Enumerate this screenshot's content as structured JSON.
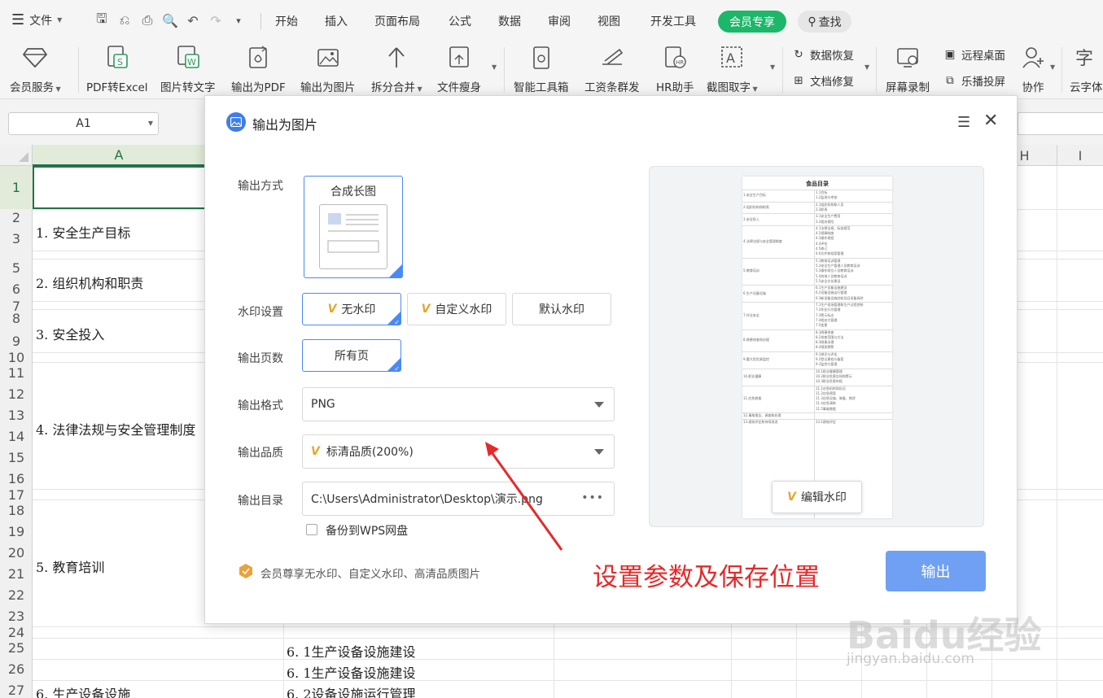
{
  "menubar": {
    "file": "文件",
    "items": [
      "开始",
      "插入",
      "页面布局",
      "公式",
      "数据",
      "审阅",
      "视图",
      "开发工具"
    ],
    "member": "会员专享",
    "search": "查找"
  },
  "ribbon": {
    "member_service": "会员服务",
    "pdf_to_excel": "PDF转Excel",
    "img_to_text": "图片转文字",
    "export_pdf": "输出为PDF",
    "export_img": "输出为图片",
    "split_merge": "拆分合并",
    "slim": "文件瘦身",
    "toolbox": "智能工具箱",
    "payslip": "工资条群发",
    "hr": "HR助手",
    "screenshot_text": "截图取字",
    "data_recovery": "数据恢复",
    "doc_repair": "文档修复",
    "screen_record": "屏幕录制",
    "remote_desktop": "远程桌面",
    "cast": "乐播投屏",
    "collab": "协作",
    "cloud_font": "云字体"
  },
  "namebox": {
    "value": "A1"
  },
  "sheet": {
    "col_a": "A",
    "col_h": "H",
    "col_i": "I",
    "rows": [
      "1",
      "2",
      "3",
      "5",
      "6",
      "7",
      "8",
      "9",
      "10",
      "11",
      "12",
      "13",
      "14",
      "15",
      "16",
      "17",
      "18",
      "19",
      "20",
      "21",
      "22",
      "23",
      "24",
      "25",
      "26",
      "27"
    ],
    "cells_a": [
      "1. 安全生产目标",
      "2. 组织机构和职责",
      "3. 安全投入",
      "4. 法律法规与安全管理制度",
      "5. 教育培训",
      "6. 生产设备设施"
    ],
    "cells_b": [
      "6. 1生产设备设施建设",
      "6. 1生产设备设施建设",
      "6. 2设备设施运行管理"
    ]
  },
  "dialog": {
    "title": "输出为图片",
    "label_mode": "输出方式",
    "mode_long": "合成长图",
    "label_watermark": "水印设置",
    "wm_none": "无水印",
    "wm_custom": "自定义水印",
    "wm_default": "默认水印",
    "label_pages": "输出页数",
    "pages_all": "所有页",
    "label_format": "输出格式",
    "format_value": "PNG",
    "label_quality": "输出品质",
    "quality_value": "标清品质(200%)",
    "label_dir": "输出目录",
    "dir_value": "C:\\Users\\Administrator\\Desktop\\演示.png",
    "backup": "备份到WPS网盘",
    "promo": "会员尊享无水印、自定义水印、高清品质图片",
    "output_btn": "输出",
    "edit_watermark": "编辑水印"
  },
  "preview": {
    "title": "食品目录",
    "sections": [
      "1.安全生产目标",
      "2.组织机构和职责",
      "3.安全投入",
      "4.法律法规与安全管理制度",
      "5.教育培训",
      "6.生产设备设施",
      "7.作业安全",
      "8.隐患排查和治理",
      "9.重大危险源监控",
      "10.职业健康",
      "11.应急救援",
      "12.事故报告、调查和处理",
      "13.绩效评定和持续改进"
    ],
    "subs": [
      "1.1目标",
      "1.2监测与考核",
      "2.1组织机构和人员",
      "2.2职责",
      "3.1安全生产费用",
      "3.2相关保险",
      "4.1法律法规、标准规范",
      "4.2规章制度",
      "4.3操作规程",
      "4.4评估",
      "4.5修订",
      "4.6文件和档案管理",
      "5.1教育培训管理",
      "5.2安全生产管理人员教育培训",
      "5.3操作岗位人员教育培训",
      "5.4其他人员教育培训",
      "5.5安全文化建设",
      "6.1生产设备设施建设",
      "6.2设备设施运行管理",
      "6.3新设备设施验收及旧设备拆除",
      "7.1生产现场管理和生产过程控制",
      "7.2作业行为管理",
      "7.3警示标志",
      "7.4相关方管理",
      "7.5变更",
      "8.1隐患排查",
      "8.2排查范围与方法",
      "8.3隐患治理",
      "8.4预测预警",
      "9.1辨识与评估",
      "9.2登记建档与备案",
      "9.3监控与管理",
      "10.1职业健康管理",
      "10.2职业危害告知和警示",
      "10.3职业危害申报",
      "11.1应急机构和队伍",
      "11.2应急预案",
      "11.3应急设施、装备、物资",
      "11.4应急演练",
      "11.5事故救援",
      "13.1绩效评定"
    ]
  },
  "annotation": "设置参数及保存位置",
  "watermark": {
    "brand": "Baidu经验",
    "url": "jingyan.baidu.com"
  },
  "colors": {
    "accent": "#4a8af4",
    "member_green": "#1db76a",
    "annotation_red": "#e52a2a",
    "excel_green": "#217346"
  }
}
